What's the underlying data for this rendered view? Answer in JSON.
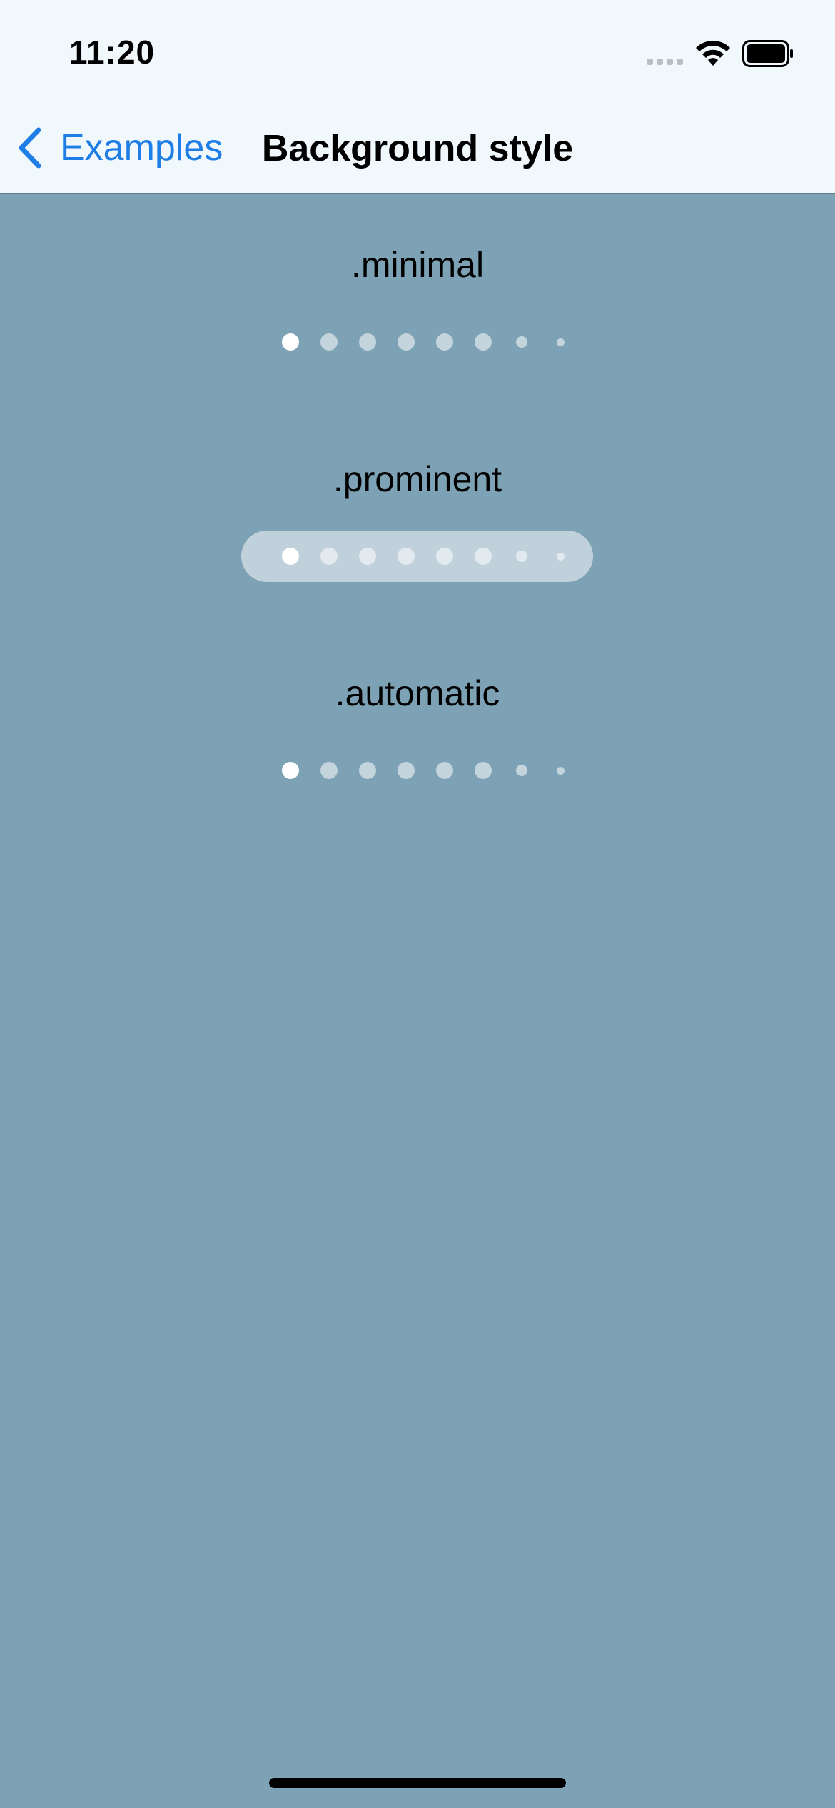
{
  "status_bar": {
    "time": "11:20"
  },
  "nav": {
    "back_label": "Examples",
    "title": "Background style"
  },
  "sections": [
    {
      "label": ".minimal",
      "page_count": 8,
      "current_page": 1
    },
    {
      "label": ".prominent",
      "page_count": 8,
      "current_page": 1
    },
    {
      "label": ".automatic",
      "page_count": 8,
      "current_page": 1
    }
  ],
  "colors": {
    "background": "#7da2b5",
    "nav_background": "#f0f8fc",
    "accent": "#1f7de6"
  }
}
